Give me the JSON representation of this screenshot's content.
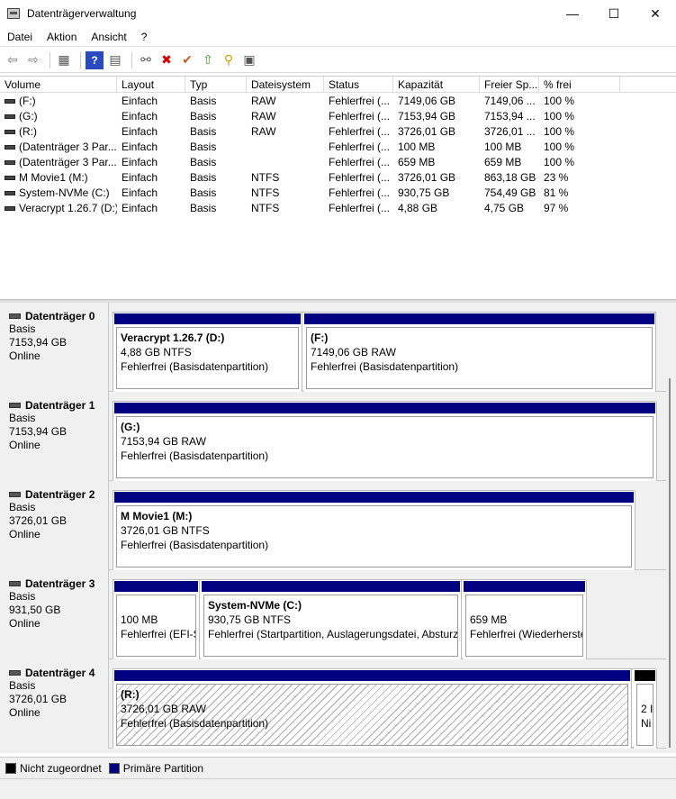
{
  "window": {
    "title": "Datenträgerverwaltung",
    "minimize": "—",
    "maximize": "☐",
    "close": "✕"
  },
  "menu": [
    "Datei",
    "Aktion",
    "Ansicht",
    "?"
  ],
  "toolbar": {
    "icons": [
      "back-icon",
      "forward-icon",
      "console-tree-icon",
      "help-icon",
      "properties-icon",
      "connect-icon",
      "delete-icon",
      "checkmark-icon",
      "up-icon",
      "search-icon",
      "export-icon"
    ],
    "glyphs": [
      "⇦",
      "⇨",
      "▦",
      "?",
      "▤",
      "⚯",
      "✖",
      "✔",
      "⇧",
      "⚲",
      "▣"
    ],
    "delete_color": "#d40000",
    "help_color": "#2a4bc0"
  },
  "list": {
    "headers": [
      "Volume",
      "Layout",
      "Typ",
      "Dateisystem",
      "Status",
      "Kapazität",
      "Freier Sp...",
      "% frei"
    ],
    "rows": [
      [
        "(F:)",
        "Einfach",
        "Basis",
        "RAW",
        "Fehlerfrei (...",
        "7149,06 GB",
        "7149,06 ...",
        "100 %"
      ],
      [
        "(G:)",
        "Einfach",
        "Basis",
        "RAW",
        "Fehlerfrei (...",
        "7153,94 GB",
        "7153,94 ...",
        "100 %"
      ],
      [
        "(R:)",
        "Einfach",
        "Basis",
        "RAW",
        "Fehlerfrei (...",
        "3726,01 GB",
        "3726,01 ...",
        "100 %"
      ],
      [
        "(Datenträger 3 Par...",
        "Einfach",
        "Basis",
        "",
        "Fehlerfrei (...",
        "100 MB",
        "100 MB",
        "100 %"
      ],
      [
        "(Datenträger 3 Par...",
        "Einfach",
        "Basis",
        "",
        "Fehlerfrei (...",
        "659 MB",
        "659 MB",
        "100 %"
      ],
      [
        "M Movie1 (M:)",
        "Einfach",
        "Basis",
        "NTFS",
        "Fehlerfrei (...",
        "3726,01 GB",
        "863,18 GB",
        "23 %"
      ],
      [
        "System-NVMe (C:)",
        "Einfach",
        "Basis",
        "NTFS",
        "Fehlerfrei (...",
        "930,75 GB",
        "754,49 GB",
        "81 %"
      ],
      [
        "Veracrypt 1.26.7 (D:)",
        "Einfach",
        "Basis",
        "NTFS",
        "Fehlerfrei (...",
        "4,88 GB",
        "4,75 GB",
        "97 %"
      ]
    ]
  },
  "disks": [
    {
      "name": "Datenträger 0",
      "type": "Basis",
      "size": "7153,94 GB",
      "status": "Online",
      "partitions": [
        {
          "name": "Veracrypt 1.26.7  (D:)",
          "size": "4,88 GB NTFS",
          "status": "Fehlerfrei (Basisdatenpartition)"
        },
        {
          "name": "(F:)",
          "size": "7149,06 GB RAW",
          "status": "Fehlerfrei (Basisdatenpartition)"
        }
      ]
    },
    {
      "name": "Datenträger 1",
      "type": "Basis",
      "size": "7153,94 GB",
      "status": "Online",
      "partitions": [
        {
          "name": "(G:)",
          "size": "7153,94 GB RAW",
          "status": "Fehlerfrei (Basisdatenpartition)"
        }
      ]
    },
    {
      "name": "Datenträger 2",
      "type": "Basis",
      "size": "3726,01 GB",
      "status": "Online",
      "partitions": [
        {
          "name": "M Movie1  (M:)",
          "size": "3726,01 GB NTFS",
          "status": "Fehlerfrei (Basisdatenpartition)"
        }
      ]
    },
    {
      "name": "Datenträger 3",
      "type": "Basis",
      "size": "931,50 GB",
      "status": "Online",
      "partitions": [
        {
          "name": "",
          "size": "100 MB",
          "status": "Fehlerfrei (EFI-S"
        },
        {
          "name": "System-NVMe  (C:)",
          "size": "930,75 GB NTFS",
          "status": "Fehlerfrei (Startpartition, Auslagerungsdatei, Absturz"
        },
        {
          "name": "",
          "size": "659 MB",
          "status": "Fehlerfrei (Wiederherste"
        }
      ]
    },
    {
      "name": "Datenträger 4",
      "type": "Basis",
      "size": "3726,01 GB",
      "status": "Online",
      "partitions": [
        {
          "name": "(R:)",
          "size": "3726,01 GB RAW",
          "status": "Fehlerfrei (Basisdatenpartition)"
        },
        {
          "name": "",
          "size": "2 I",
          "status": "Ni"
        }
      ]
    }
  ],
  "legend": {
    "unallocated": "Nicht zugeordnet",
    "primary": "Primäre Partition",
    "unallocated_color": "#000000",
    "primary_color": "#000080"
  }
}
